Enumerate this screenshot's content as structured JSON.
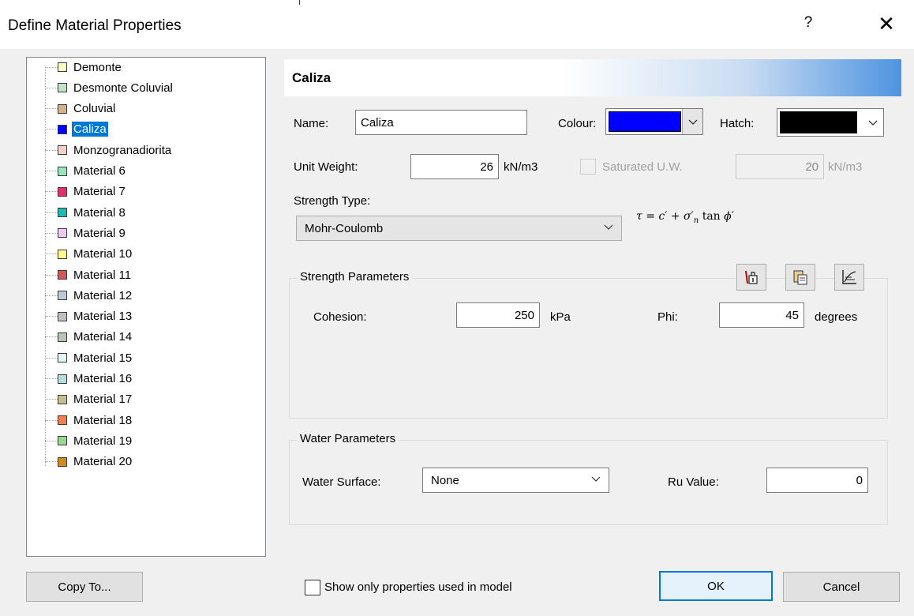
{
  "window": {
    "title": "Define Material Properties",
    "help_glyph": "?",
    "close_glyph": "✕"
  },
  "materials": [
    {
      "label": "Demonte",
      "color": "#ffffc8"
    },
    {
      "label": "Desmonte Coluvial",
      "color": "#c6e0c6"
    },
    {
      "label": "Coluvial",
      "color": "#d2b48c"
    },
    {
      "label": "Caliza",
      "color": "#0000ff",
      "selected": true
    },
    {
      "label": "Monzogranadiorita",
      "color": "#f6cfcf"
    },
    {
      "label": "Material 6",
      "color": "#98e6b8"
    },
    {
      "label": "Material 7",
      "color": "#e0306e"
    },
    {
      "label": "Material 8",
      "color": "#20b8b0"
    },
    {
      "label": "Material 9",
      "color": "#f0c8f0"
    },
    {
      "label": "Material 10",
      "color": "#ffff90"
    },
    {
      "label": "Material 11",
      "color": "#d05858"
    },
    {
      "label": "Material 12",
      "color": "#c0c8d8"
    },
    {
      "label": "Material 13",
      "color": "#c0c0c0"
    },
    {
      "label": "Material 14",
      "color": "#b4c8b4"
    },
    {
      "label": "Material 15",
      "color": "#e0f8f8"
    },
    {
      "label": "Material 16",
      "color": "#b8dcdc"
    },
    {
      "label": "Material 17",
      "color": "#c8c08c"
    },
    {
      "label": "Material 18",
      "color": "#f08050"
    },
    {
      "label": "Material 19",
      "color": "#98d890"
    },
    {
      "label": "Material 20",
      "color": "#d08c20"
    }
  ],
  "header": {
    "title": "Caliza"
  },
  "props": {
    "name_label": "Name:",
    "name_value": "Caliza",
    "colour_label": "Colour:",
    "colour_value": "#0000ff",
    "hatch_label": "Hatch:",
    "hatch_value": "#000000",
    "unit_weight_label": "Unit Weight:",
    "unit_weight_value": "26",
    "unit_weight_unit": "kN/m3",
    "saturated_label": "Saturated U.W.",
    "saturated_value": "20",
    "saturated_unit": "kN/m3",
    "strength_type_label": "Strength Type:",
    "strength_type_value": "Mohr-Coulomb"
  },
  "strength": {
    "group_title": "Strength Parameters",
    "cohesion_label": "Cohesion:",
    "cohesion_value": "250",
    "cohesion_unit": "kPa",
    "phi_label": "Phi:",
    "phi_value": "45",
    "phi_unit": "degrees",
    "icons": [
      "load-icon",
      "paste-icon",
      "graph-icon"
    ]
  },
  "water": {
    "group_title": "Water Parameters",
    "surface_label": "Water Surface:",
    "surface_value": "None",
    "ru_label": "Ru Value:",
    "ru_value": "0"
  },
  "footer": {
    "copy_to_label": "Copy To...",
    "show_only_label": "Show only properties used in model",
    "ok_label": "OK",
    "cancel_label": "Cancel"
  }
}
